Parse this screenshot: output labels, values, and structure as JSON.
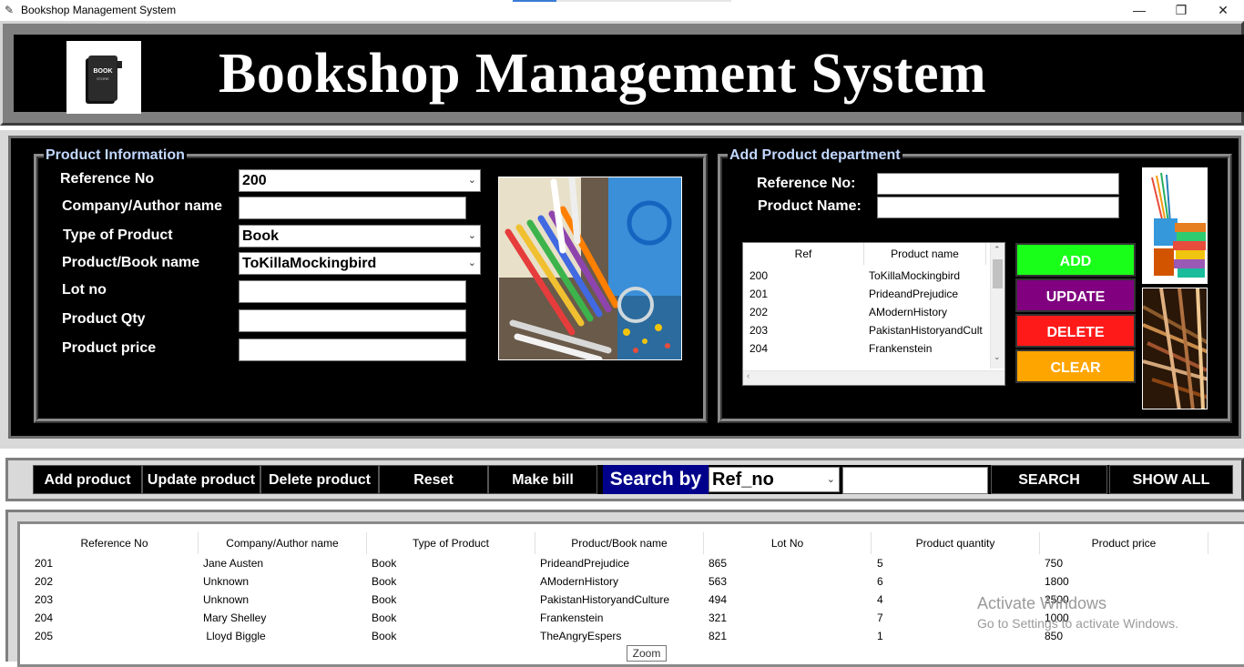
{
  "window": {
    "title": "Bookshop Management System",
    "controls": {
      "minimize": "—",
      "maximize": "❐",
      "close": "✕"
    }
  },
  "header": {
    "logo_text": "BOOK",
    "logo_subtext": "STORE",
    "title": "Bookshop Management System"
  },
  "product_info": {
    "group_title": "Product Information",
    "labels": {
      "reference_no": "Reference No",
      "company_author": "Company/Author name",
      "type_of_product": "Type of Product",
      "product_book_name": "Product/Book name",
      "lot_no": "Lot no",
      "product_qty": "Product Qty",
      "product_price": "Product price"
    },
    "values": {
      "reference_no": "200",
      "company_author": "",
      "type_of_product": "Book",
      "product_book_name": "ToKillaMockingbird",
      "lot_no": "",
      "product_qty": "",
      "product_price": ""
    }
  },
  "add_department": {
    "group_title": "Add Product department",
    "labels": {
      "reference_no": "Reference No:",
      "product_name": "Product Name:"
    },
    "values": {
      "reference_no": "",
      "product_name": ""
    },
    "list_headers": [
      "Ref",
      "Product name"
    ],
    "list_rows": [
      {
        "ref": "200",
        "name": "ToKillaMockingbird"
      },
      {
        "ref": "201",
        "name": "PrideandPrejudice"
      },
      {
        "ref": "202",
        "name": "AModernHistory"
      },
      {
        "ref": "203",
        "name": "PakistanHistoryandCult"
      },
      {
        "ref": "204",
        "name": "Frankenstein"
      }
    ],
    "buttons": {
      "add": "ADD",
      "update": "UPDATE",
      "delete": "DELETE",
      "clear": "CLEAR"
    },
    "button_colors": {
      "add": "#1aff1a",
      "update": "#800080",
      "delete": "#ff1a1a",
      "clear": "#ffa500"
    }
  },
  "toolbar": {
    "add_product": "Add product",
    "update_product": "Update product",
    "delete_product": "Delete product",
    "reset": "Reset",
    "make_bill": "Make bill",
    "search_by": "Search by",
    "search_by_value": "Ref_no",
    "search_value": "",
    "search": "SEARCH",
    "show_all": "SHOW ALL"
  },
  "table": {
    "headers": [
      "Reference No",
      "Company/Author name",
      "Type of Product",
      "Product/Book name",
      "Lot No",
      "Product quantity",
      "Product price"
    ],
    "rows": [
      [
        "201",
        "Jane Austen",
        "Book",
        "PrideandPrejudice",
        "865",
        "5",
        "750"
      ],
      [
        "202",
        "Unknown",
        "Book",
        "AModernHistory",
        "563",
        "6",
        "1800"
      ],
      [
        "203",
        "Unknown",
        "Book",
        "PakistanHistoryandCulture",
        "494",
        "4",
        "2500"
      ],
      [
        "204",
        "Mary Shelley",
        "Book",
        "Frankenstein",
        "321",
        "7",
        "1000"
      ],
      [
        "205",
        " Lloyd Biggle",
        "Book",
        "TheAngryEspers",
        "821",
        "1",
        "850"
      ]
    ]
  },
  "os_overlay": {
    "watermark_title": "Activate Windows",
    "watermark_sub": "Go to Settings to activate Windows.",
    "tooltip": "Zoom"
  }
}
